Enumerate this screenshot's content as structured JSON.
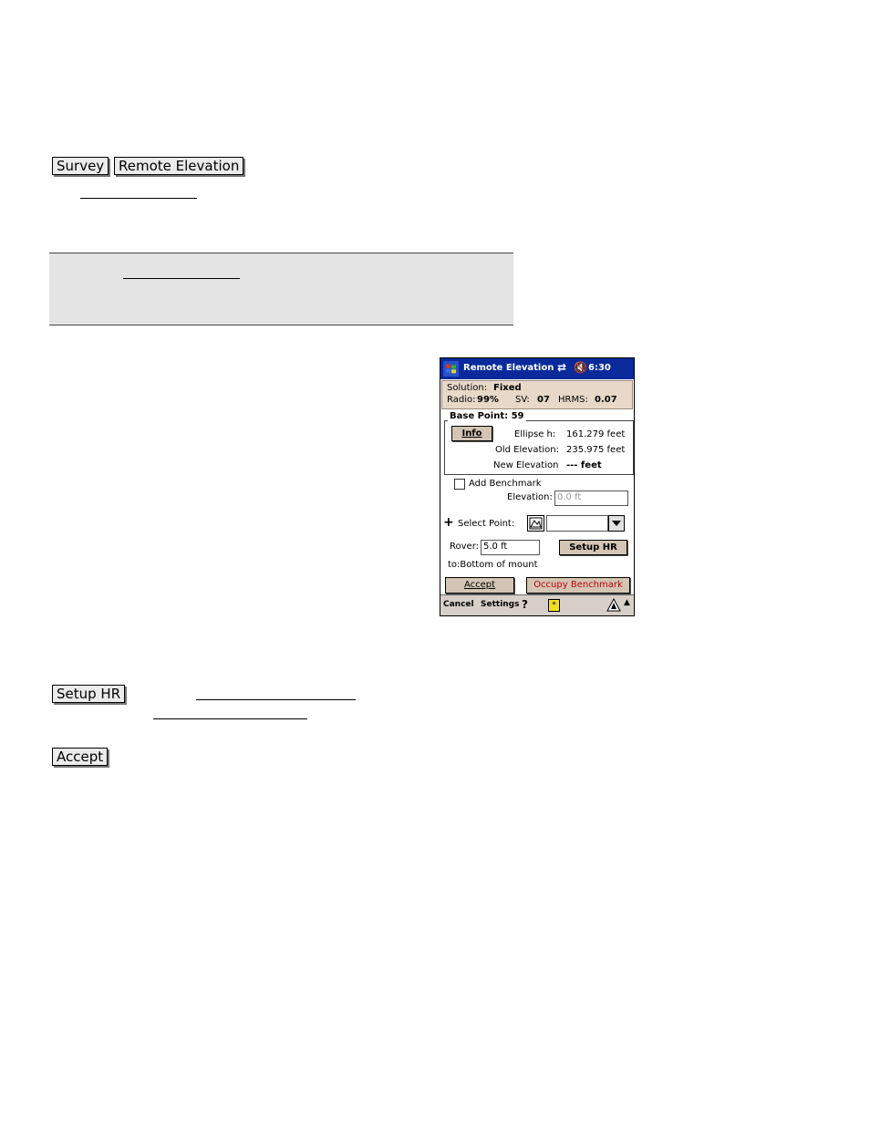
{
  "doc": {
    "buttons": {
      "survey": "Survey",
      "remote_elevation": "Remote Elevation",
      "setup_hr": "Setup HR",
      "accept": "Accept"
    }
  },
  "pda": {
    "title": "Remote Elevation",
    "time": "6:30",
    "status": {
      "solution_label": "Solution:",
      "solution_value": "Fixed",
      "radio_label": "Radio:",
      "radio_value": "99%",
      "sv_label": "SV:",
      "sv_value": "07",
      "hrms_label": "HRMS:",
      "hrms_value": "0.07"
    },
    "base_point": {
      "title": "Base Point: 59",
      "info_button": "Info",
      "ellipse_label": "Ellipse h:",
      "ellipse_value": "161.279 feet",
      "old_elev_label": "Old Elevation:",
      "old_elev_value": "235.975 feet",
      "new_elev_label": "New Elevation",
      "new_elev_value": "--- feet"
    },
    "add_benchmark_label": "Add Benchmark",
    "elevation_label": "Elevation:",
    "elevation_value": "0.0 ft",
    "select_point_label": "Select Point:",
    "select_point_value": "",
    "rover_label": "Rover:",
    "rover_value": "5.0 ft",
    "setup_hr_button": "Setup HR",
    "to_text": "to:Bottom of mount",
    "accept_button": "Accept",
    "occupy_button": "Occupy Benchmark",
    "menu": {
      "cancel": "Cancel",
      "settings": "Settings"
    }
  }
}
